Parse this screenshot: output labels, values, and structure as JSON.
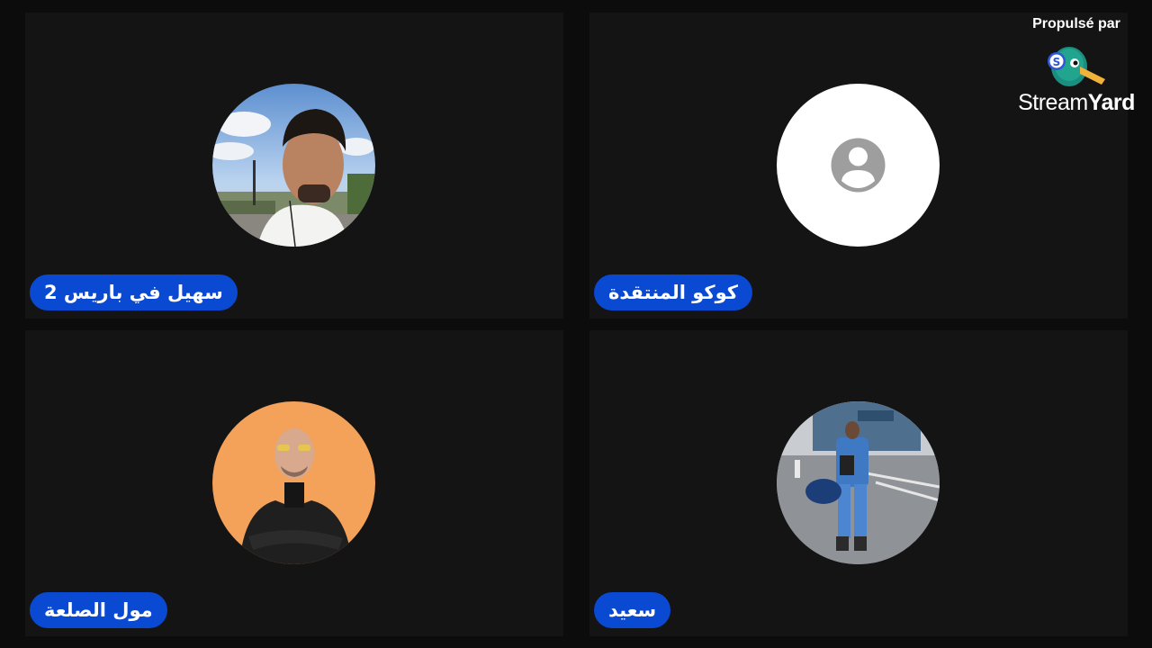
{
  "branding": {
    "powered_by": "Propulsé par",
    "brand_part1": "Stream",
    "brand_part2": "Yard",
    "mascot_icon": "duck-mascot-icon",
    "mascot_letter": "S"
  },
  "participants": [
    {
      "name": "سهيل في باريس 2",
      "avatar": "photo"
    },
    {
      "name": "كوكو المنتقدة",
      "avatar": "default-user-icon"
    },
    {
      "name": "مول الصلعة",
      "avatar": "photo"
    },
    {
      "name": "سعيد",
      "avatar": "photo"
    }
  ],
  "colors": {
    "badge": "#0a49d1",
    "tile": "#141414",
    "background": "#0c0c0c"
  }
}
